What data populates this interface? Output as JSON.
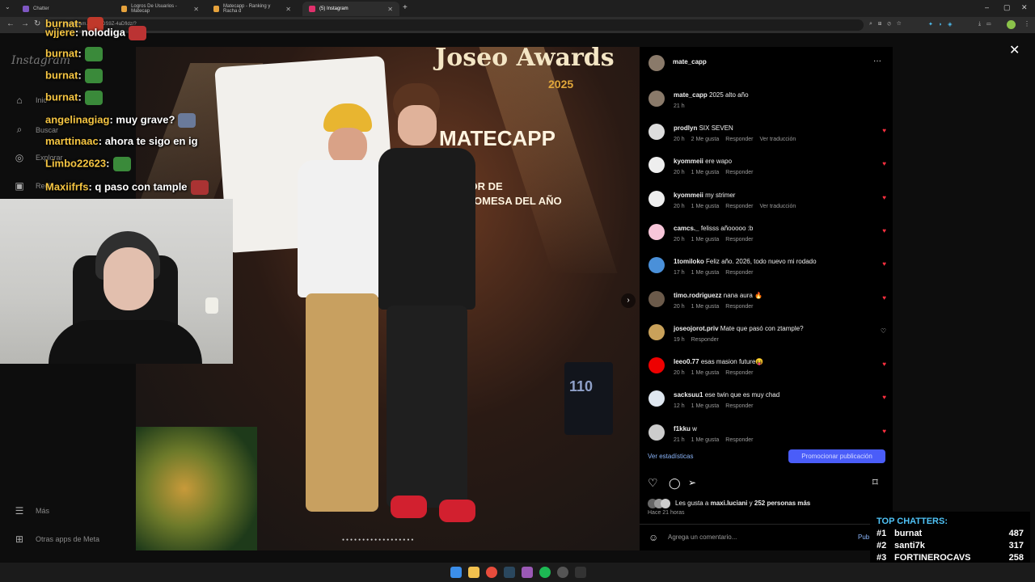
{
  "browser": {
    "tabs": [
      {
        "label": "Chatter"
      },
      {
        "label": "Logros De Usuarios - Matecap"
      },
      {
        "label": "Matecapp - Ranking y Racha d"
      },
      {
        "label": "(5) Instagram"
      }
    ],
    "url": "instagram.com/p/DS9Z-4aDfldz/?"
  },
  "instagram": {
    "logo": "Instagram",
    "nav": [
      {
        "label": "Inic",
        "icon": "home-icon"
      },
      {
        "label": "Buscar",
        "icon": "search-icon"
      },
      {
        "label": "Explorar",
        "icon": "compass-icon"
      },
      {
        "label": "Reel",
        "icon": "reels-icon"
      },
      {
        "label": "Más",
        "icon": "menu-icon"
      },
      {
        "label": "Otras apps de Meta",
        "icon": "meta-icon"
      }
    ],
    "post": {
      "author": "mate_capp",
      "caption_user": "mate_capp",
      "caption_text": "2025 alto año",
      "caption_time": "21 h",
      "photo_text_1": "Joseo Awards",
      "photo_text_2": "2025",
      "photo_text_3": "MATECAPP",
      "photo_text_4": "ANADOR DE",
      "photo_text_5": "PROMESA DEL AÑO",
      "photo_text_6": "110",
      "stats_link": "Ver estadísticas",
      "promote_label": "Promocionar publicación",
      "likes_prefix": "Les gusta a",
      "likes_user": "maxi.luciani",
      "likes_and": "y",
      "likes_count": "252 personas más",
      "posted_ago": "Hace 21 horas",
      "comment_placeholder": "Agrega un comentario...",
      "publish_label": "Pub"
    },
    "comments": [
      {
        "user": "prodlyn",
        "text": "SIX SEVEN",
        "time": "20 h",
        "likes": "2 Me gusta",
        "reply": "Responder",
        "translate": "Ver traducción"
      },
      {
        "user": "kyommeii",
        "text": "ere wapo",
        "time": "20 h",
        "likes": "1 Me gusta",
        "reply": "Responder",
        "translate": ""
      },
      {
        "user": "kyommeii",
        "text": "my strimer",
        "time": "20 h",
        "likes": "1 Me gusta",
        "reply": "Responder",
        "translate": "Ver traducción"
      },
      {
        "user": "camcs._",
        "text": "felisss añooooo :b",
        "time": "20 h",
        "likes": "1 Me gusta",
        "reply": "Responder",
        "translate": ""
      },
      {
        "user": "1tomiloko",
        "text": "Feliz año. 2026, todo nuevo mi rodado",
        "time": "17 h",
        "likes": "1 Me gusta",
        "reply": "Responder",
        "translate": ""
      },
      {
        "user": "timo.rodriguezz",
        "text": "nana aura 🔥",
        "time": "20 h",
        "likes": "1 Me gusta",
        "reply": "Responder",
        "translate": ""
      },
      {
        "user": "joseojorot.priv",
        "text": "Mate que pasó con ztample?",
        "time": "19 h",
        "likes": "",
        "reply": "Responder",
        "translate": ""
      },
      {
        "user": "leeo0.77",
        "text": "esas masion future😝",
        "time": "20 h",
        "likes": "1 Me gusta",
        "reply": "Responder",
        "translate": ""
      },
      {
        "user": "sacksuu1",
        "text": "ese twin que es muy chad",
        "time": "12 h",
        "likes": "1 Me gusta",
        "reply": "Responder",
        "translate": ""
      },
      {
        "user": "f1kku",
        "text": "w",
        "time": "21 h",
        "likes": "1 Me gusta",
        "reply": "Responder",
        "translate": ""
      }
    ]
  },
  "stream_chat": [
    {
      "user": "wjjere",
      "text": ": nolodiga"
    },
    {
      "user": "burnat",
      "text": ":"
    },
    {
      "user": "burnat",
      "text": ":"
    },
    {
      "user": "burnat",
      "text": ":"
    },
    {
      "user": "angelinagiag",
      "text": ": muy grave?"
    },
    {
      "user": "marttinaac",
      "text": ": ahora te sigo en ig"
    },
    {
      "user": "Limbo22623",
      "text": ":"
    },
    {
      "user": "Maxiifrfs",
      "text": ": q paso con tample"
    }
  ],
  "tab_overlay_user": "burnat:",
  "top_chatters": {
    "title": "TOP CHATTERS:",
    "rows": [
      {
        "rank": "#1",
        "name": "burnat",
        "count": "487"
      },
      {
        "rank": "#2",
        "name": "santi7k",
        "count": "317"
      },
      {
        "rank": "#3",
        "name": "FORTINEROCAVS",
        "count": "258"
      }
    ]
  },
  "colors": {
    "accent": "#4a5df9",
    "like": "#ff3040",
    "chat_user": "#f5c542",
    "chatters_title": "#4fc3f7"
  }
}
